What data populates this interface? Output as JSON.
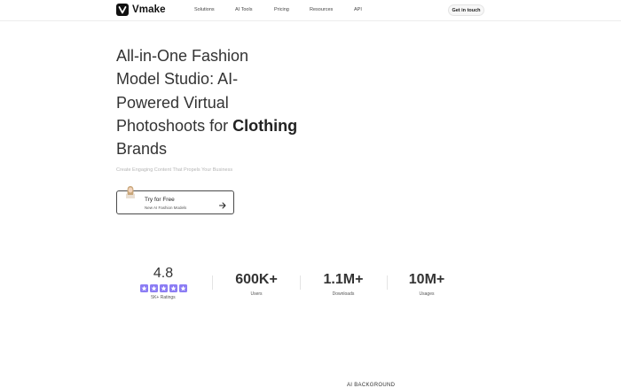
{
  "nav": {
    "logo_text": "Vmake",
    "links": [
      "Solutions",
      "AI Tools",
      "Pricing",
      "Resources",
      "API"
    ],
    "contact_label": "Get in touch"
  },
  "hero": {
    "title_line1": "All-in-One Fashion",
    "title_line2": "Model Studio: AI-",
    "title_line3": "Powered Virtual",
    "title_line4_a": "Photoshoots for ",
    "title_line4_b": "Clothing",
    "title_line5": "Brands",
    "subtitle": "Create Engaging Content That Propels Your Business",
    "cta_label": "Try for Free",
    "cta_sublabel": "New AI Fashion Models"
  },
  "stats": {
    "rating": {
      "value": "4.8",
      "label": "5K+ Ratings",
      "stars": 5
    },
    "users": {
      "value": "600K+",
      "label": "Users"
    },
    "downloads": {
      "value": "1.1M+",
      "label": "Downloads"
    },
    "usages": {
      "value": "10M+",
      "label": "Usages"
    }
  },
  "section_heading": "AI BACKGROUND",
  "colors": {
    "star": "#8b7cf4",
    "text_dark": "#222222",
    "subtitle": "#b5b5b5"
  }
}
